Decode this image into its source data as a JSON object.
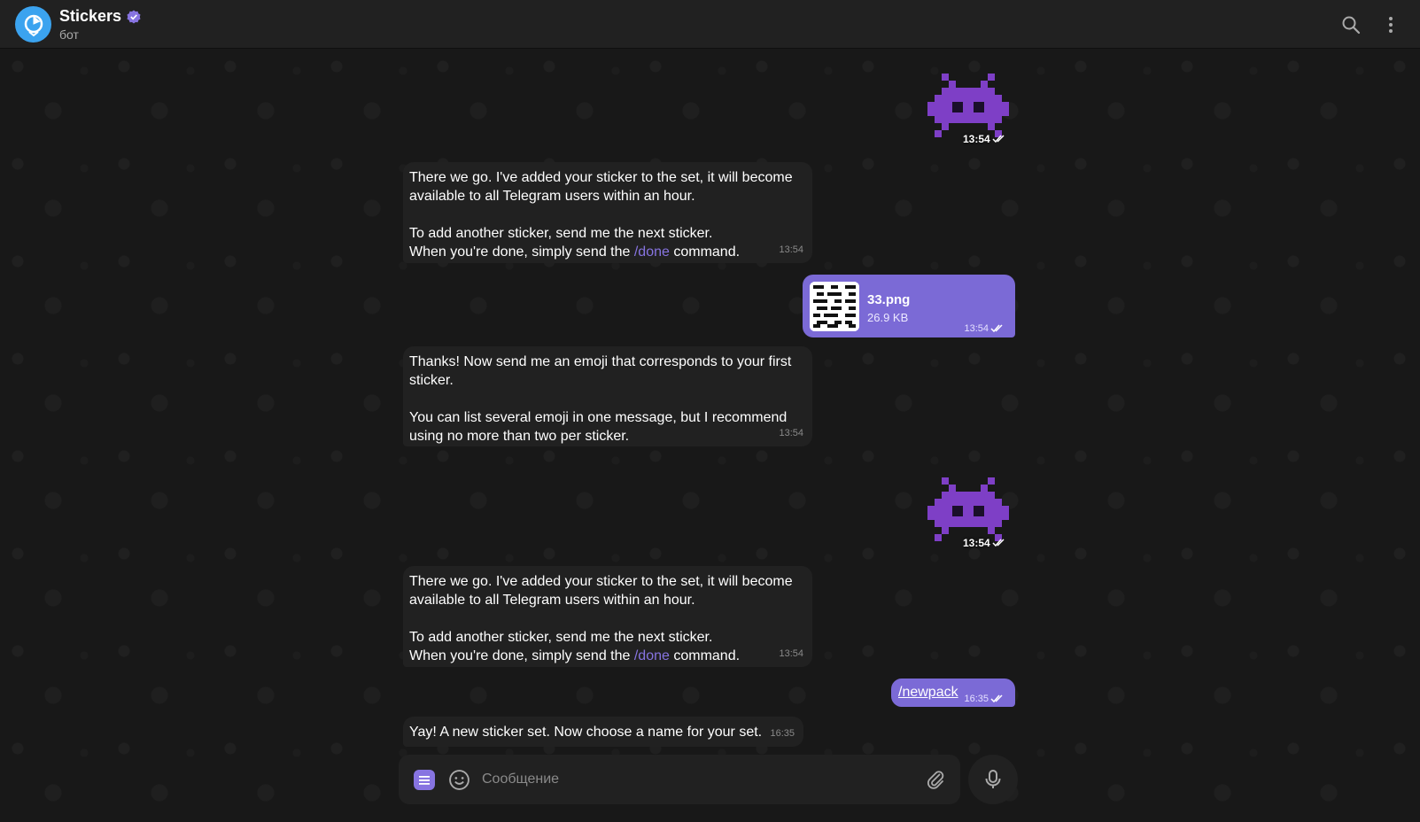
{
  "header": {
    "title": "Stickers",
    "subtitle": "бот"
  },
  "messages": {
    "sticker1_time": "13:54",
    "msg1": {
      "line1": "There we go. I've added your sticker to the set, it will become available to all Telegram users within an hour.",
      "line2": "To add another sticker, send me the next sticker.",
      "line3_pre": "When you're done, simply send the ",
      "line3_cmd": "/done",
      "line3_post": " command.",
      "time": "13:54"
    },
    "file": {
      "name": "33.png",
      "size": "26.9 KB",
      "time": "13:54"
    },
    "msg2": {
      "para1": "Thanks! Now send me an emoji that corresponds to your first sticker.",
      "para2": "You can list several emoji in one message, but I recommend using no more than two per sticker.",
      "time": "13:54"
    },
    "sticker2_time": "13:54",
    "msg3": {
      "line1": "There we go. I've added your sticker to the set, it will become available to all Telegram users within an hour.",
      "line2": "To add another sticker, send me the next sticker.",
      "line3_pre": "When you're done, simply send the ",
      "line3_cmd": "/done",
      "line3_post": " command.",
      "time": "13:54"
    },
    "out_cmd": {
      "text": "/newpack",
      "time": "16:35"
    },
    "msg4": {
      "text": "Yay! A new sticker set. Now choose a name for your set.",
      "time": "16:35"
    }
  },
  "composer": {
    "placeholder": "Сообщение"
  },
  "colors": {
    "accent": "#8774e1",
    "outgoing": "#7b6ad6",
    "incoming": "#212121",
    "avatar": "#3ba3ef"
  }
}
